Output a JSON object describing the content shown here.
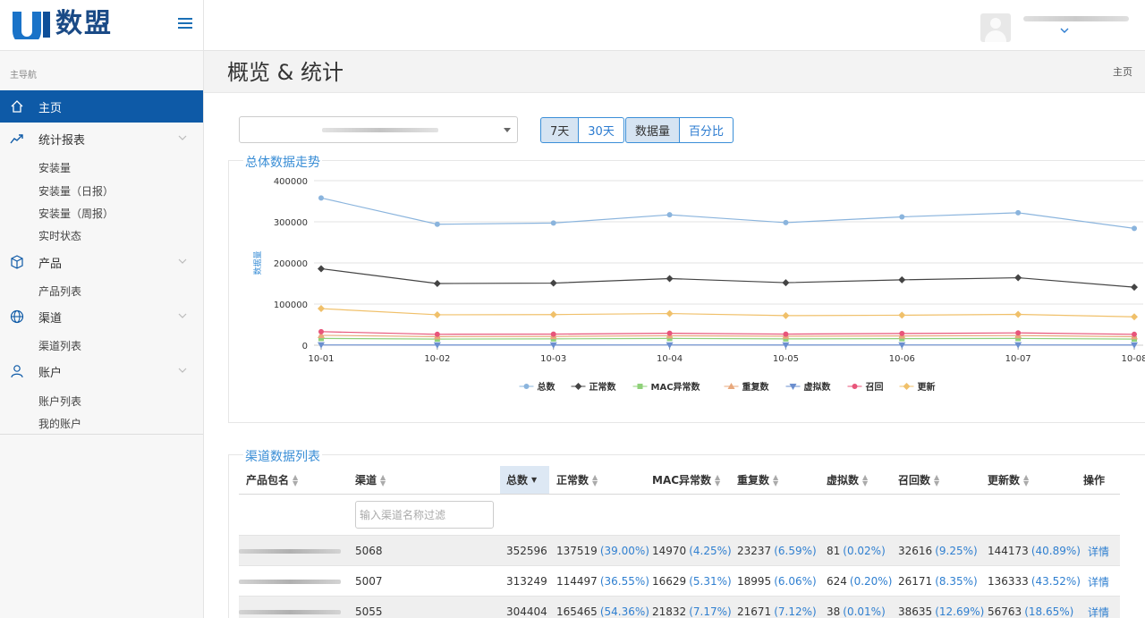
{
  "app": {
    "logo_text": "数盟",
    "user_chevron": "chevron-down-icon"
  },
  "sidebar": {
    "caption": "主导航",
    "items": [
      {
        "label": "主页",
        "icon": "home-icon",
        "active": true
      },
      {
        "label": "统计报表",
        "icon": "trend-icon",
        "children": [
          "安装量",
          "安装量（日报）",
          "安装量（周报）",
          "实时状态"
        ]
      },
      {
        "label": "产品",
        "icon": "box-icon",
        "children": [
          "产品列表"
        ]
      },
      {
        "label": "渠道",
        "icon": "globe-icon",
        "children": [
          "渠道列表"
        ]
      },
      {
        "label": "账户",
        "icon": "user-icon",
        "children": [
          "账户列表",
          "我的账户"
        ]
      }
    ]
  },
  "header": {
    "title": "概览 & 统计",
    "breadcrumb": "主页"
  },
  "filters": {
    "range_buttons": [
      "7天",
      "30天"
    ],
    "range_selected": "7天",
    "mode_buttons": [
      "数据量",
      "百分比"
    ],
    "mode_selected": "数据量"
  },
  "trend_panel": {
    "title": "总体数据走势"
  },
  "chart_data": {
    "type": "line",
    "title": "",
    "xlabel": "",
    "ylabel": "数据量",
    "ylim": [
      0,
      400000
    ],
    "yticks": [
      0,
      100000,
      200000,
      300000,
      400000
    ],
    "categories": [
      "10-01",
      "10-02",
      "10-03",
      "10-04",
      "10-05",
      "10-06",
      "10-07",
      "10-08"
    ],
    "grid": true,
    "legend_position": "bottom",
    "series": [
      {
        "name": "总数",
        "color": "#8ab4dd",
        "marker": "circle",
        "values": [
          358000,
          294000,
          297000,
          317000,
          298000,
          312000,
          322000,
          284000
        ]
      },
      {
        "name": "正常数",
        "color": "#444444",
        "marker": "diamond",
        "values": [
          186000,
          150000,
          151000,
          162000,
          152000,
          159000,
          164000,
          141000
        ]
      },
      {
        "name": "MAC异常数",
        "color": "#8fd17a",
        "marker": "square",
        "values": [
          16500,
          15000,
          15500,
          16500,
          15500,
          16000,
          16500,
          15000
        ]
      },
      {
        "name": "重复数",
        "color": "#e8a87c",
        "marker": "triangle-up",
        "values": [
          24000,
          21000,
          21500,
          23000,
          22000,
          22500,
          23500,
          21000
        ]
      },
      {
        "name": "虚拟数",
        "color": "#6b8fcf",
        "marker": "triangle-down",
        "values": [
          700,
          600,
          600,
          650,
          600,
          650,
          700,
          600
        ]
      },
      {
        "name": "召回",
        "color": "#e8557a",
        "marker": "circle",
        "values": [
          33000,
          26500,
          27000,
          29000,
          27000,
          28500,
          30000,
          26500
        ]
      },
      {
        "name": "更新",
        "color": "#f0c06a",
        "marker": "diamond",
        "values": [
          89000,
          74000,
          74500,
          77000,
          72000,
          73000,
          75000,
          69000
        ]
      }
    ]
  },
  "channel_panel": {
    "title": "渠道数据列表",
    "filter_placeholder": "输入渠道名称过滤",
    "columns": [
      "产品包名",
      "渠道",
      "总数",
      "正常数",
      "MAC异常数",
      "重复数",
      "虚拟数",
      "召回数",
      "更新数",
      "操作"
    ],
    "sorted_column": "总数",
    "rows": [
      {
        "channel": "5068",
        "total": "352596",
        "normal": "137519",
        "normal_pct": "(39.00%)",
        "mac": "14970",
        "mac_pct": "(4.25%)",
        "dup": "23237",
        "dup_pct": "(6.59%)",
        "virt": "81",
        "virt_pct": "(0.02%)",
        "recall": "32616",
        "recall_pct": "(9.25%)",
        "update": "144173",
        "update_pct": "(40.89%)",
        "action": "详情"
      },
      {
        "channel": "5007",
        "total": "313249",
        "normal": "114497",
        "normal_pct": "(36.55%)",
        "mac": "16629",
        "mac_pct": "(5.31%)",
        "dup": "18995",
        "dup_pct": "(6.06%)",
        "virt": "624",
        "virt_pct": "(0.20%)",
        "recall": "26171",
        "recall_pct": "(8.35%)",
        "update": "136333",
        "update_pct": "(43.52%)",
        "action": "详情"
      },
      {
        "channel": "5055",
        "total": "304404",
        "normal": "165465",
        "normal_pct": "(54.36%)",
        "mac": "21832",
        "mac_pct": "(7.17%)",
        "dup": "21671",
        "dup_pct": "(7.12%)",
        "virt": "38",
        "virt_pct": "(0.01%)",
        "recall": "38635",
        "recall_pct": "(12.69%)",
        "update": "56763",
        "update_pct": "(18.65%)",
        "action": "详情"
      }
    ]
  }
}
